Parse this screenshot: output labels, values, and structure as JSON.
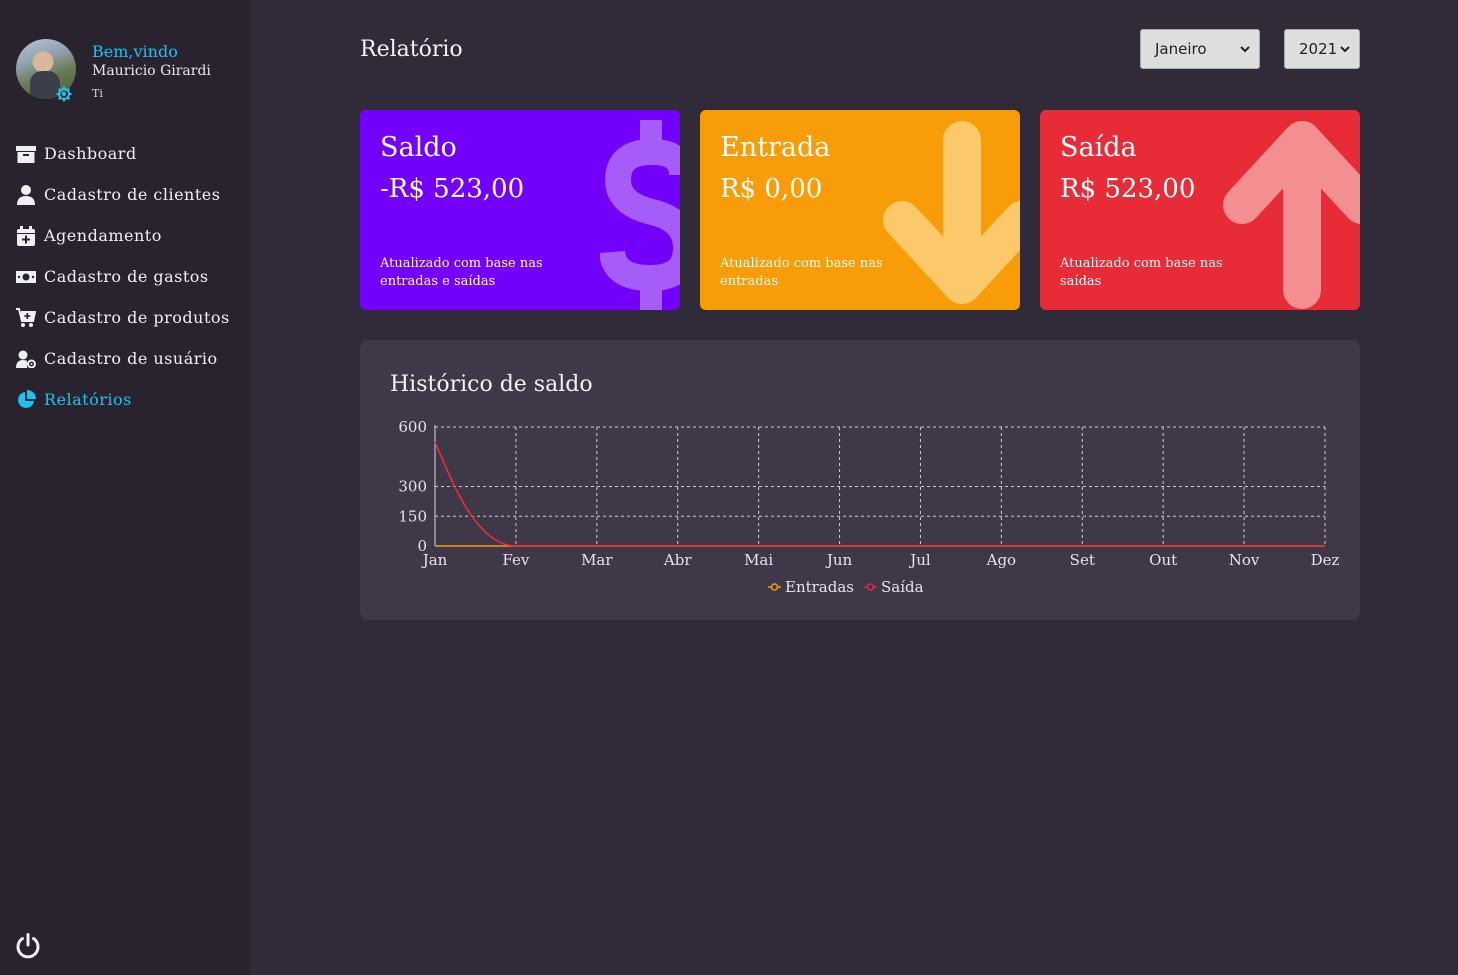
{
  "sidebar": {
    "welcome": "Bem,vindo",
    "user_name": "Mauricio Girardi",
    "user_role": "Ti",
    "items": [
      {
        "label": "Dashboard",
        "icon": "archive-icon"
      },
      {
        "label": "Cadastro de clientes",
        "icon": "user-icon"
      },
      {
        "label": "Agendamento",
        "icon": "calendar-plus-icon"
      },
      {
        "label": "Cadastro de gastos",
        "icon": "money-bill-icon"
      },
      {
        "label": "Cadastro de produtos",
        "icon": "cart-plus-icon"
      },
      {
        "label": "Cadastro de usuário",
        "icon": "user-cog-icon"
      },
      {
        "label": "Relatórios",
        "icon": "chart-pie-icon",
        "active": true
      }
    ],
    "logout_icon": "power-icon"
  },
  "header": {
    "title": "Relatório",
    "month_selected": "Janeiro",
    "year_selected": "2021"
  },
  "cards": {
    "saldo": {
      "title": "Saldo",
      "value": "-R$ 523,00",
      "note": "Atualizado com base nas entradas e saídas",
      "color": "#7300fa",
      "icon": "dollar-icon"
    },
    "entrada": {
      "title": "Entrada",
      "value": "R$ 0,00",
      "note": "Atualizado com base nas entradas",
      "color": "#f89c08",
      "icon": "arrow-down-icon"
    },
    "saida": {
      "title": "Saída",
      "value": "R$ 523,00",
      "note": "Atualizado com base nas saídas",
      "color": "#e72c38",
      "icon": "arrow-up-icon"
    }
  },
  "chart": {
    "title": "Histórico de saldo"
  },
  "chart_data": {
    "type": "line",
    "categories": [
      "Jan",
      "Fev",
      "Mar",
      "Abr",
      "Mai",
      "Jun",
      "Jul",
      "Ago",
      "Set",
      "Out",
      "Nov",
      "Dez"
    ],
    "yticks": [
      0,
      150,
      300,
      600
    ],
    "ylim": [
      0,
      600
    ],
    "grid": true,
    "legend_position": "bottom",
    "series": [
      {
        "name": "Entradas",
        "color": "#f89c08",
        "values": [
          0,
          0,
          0,
          0,
          0,
          0,
          0,
          0,
          0,
          0,
          0,
          0
        ]
      },
      {
        "name": "Saída",
        "color": "#e72c38",
        "values": [
          523,
          0,
          0,
          0,
          0,
          0,
          0,
          0,
          0,
          0,
          0,
          0
        ]
      }
    ]
  }
}
